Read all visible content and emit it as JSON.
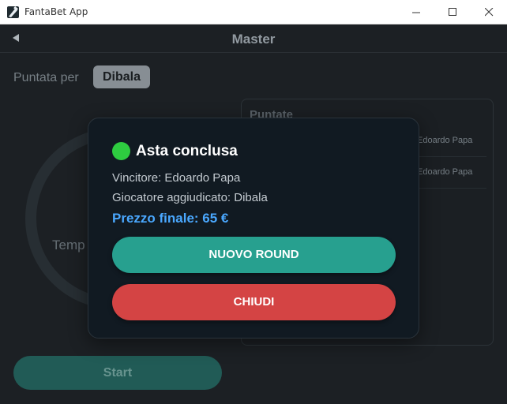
{
  "window": {
    "title": "FantaBet App"
  },
  "header": {
    "title": "Master"
  },
  "background": {
    "bid_for_label": "Puntata per",
    "player_chip": "Dibala",
    "timer_label": "Temp",
    "bids_panel": {
      "title": "Puntate",
      "rows": [
        {
          "name": "Edoardo Papa"
        },
        {
          "name": "Edoardo Papa"
        }
      ]
    },
    "start_label": "Start"
  },
  "modal": {
    "title": "Asta conclusa",
    "winner": "Vincitore: Edoardo Papa",
    "player": "Giocatore aggiudicato: Dibala",
    "final_price": "Prezzo finale: 65 €",
    "new_round_label": "NUOVO ROUND",
    "close_label": "CHIUDI",
    "status_color": "#2ecc40"
  },
  "colors": {
    "accent_green": "#27a08f",
    "danger_red": "#d44444",
    "price_blue": "#4aa8ff"
  }
}
